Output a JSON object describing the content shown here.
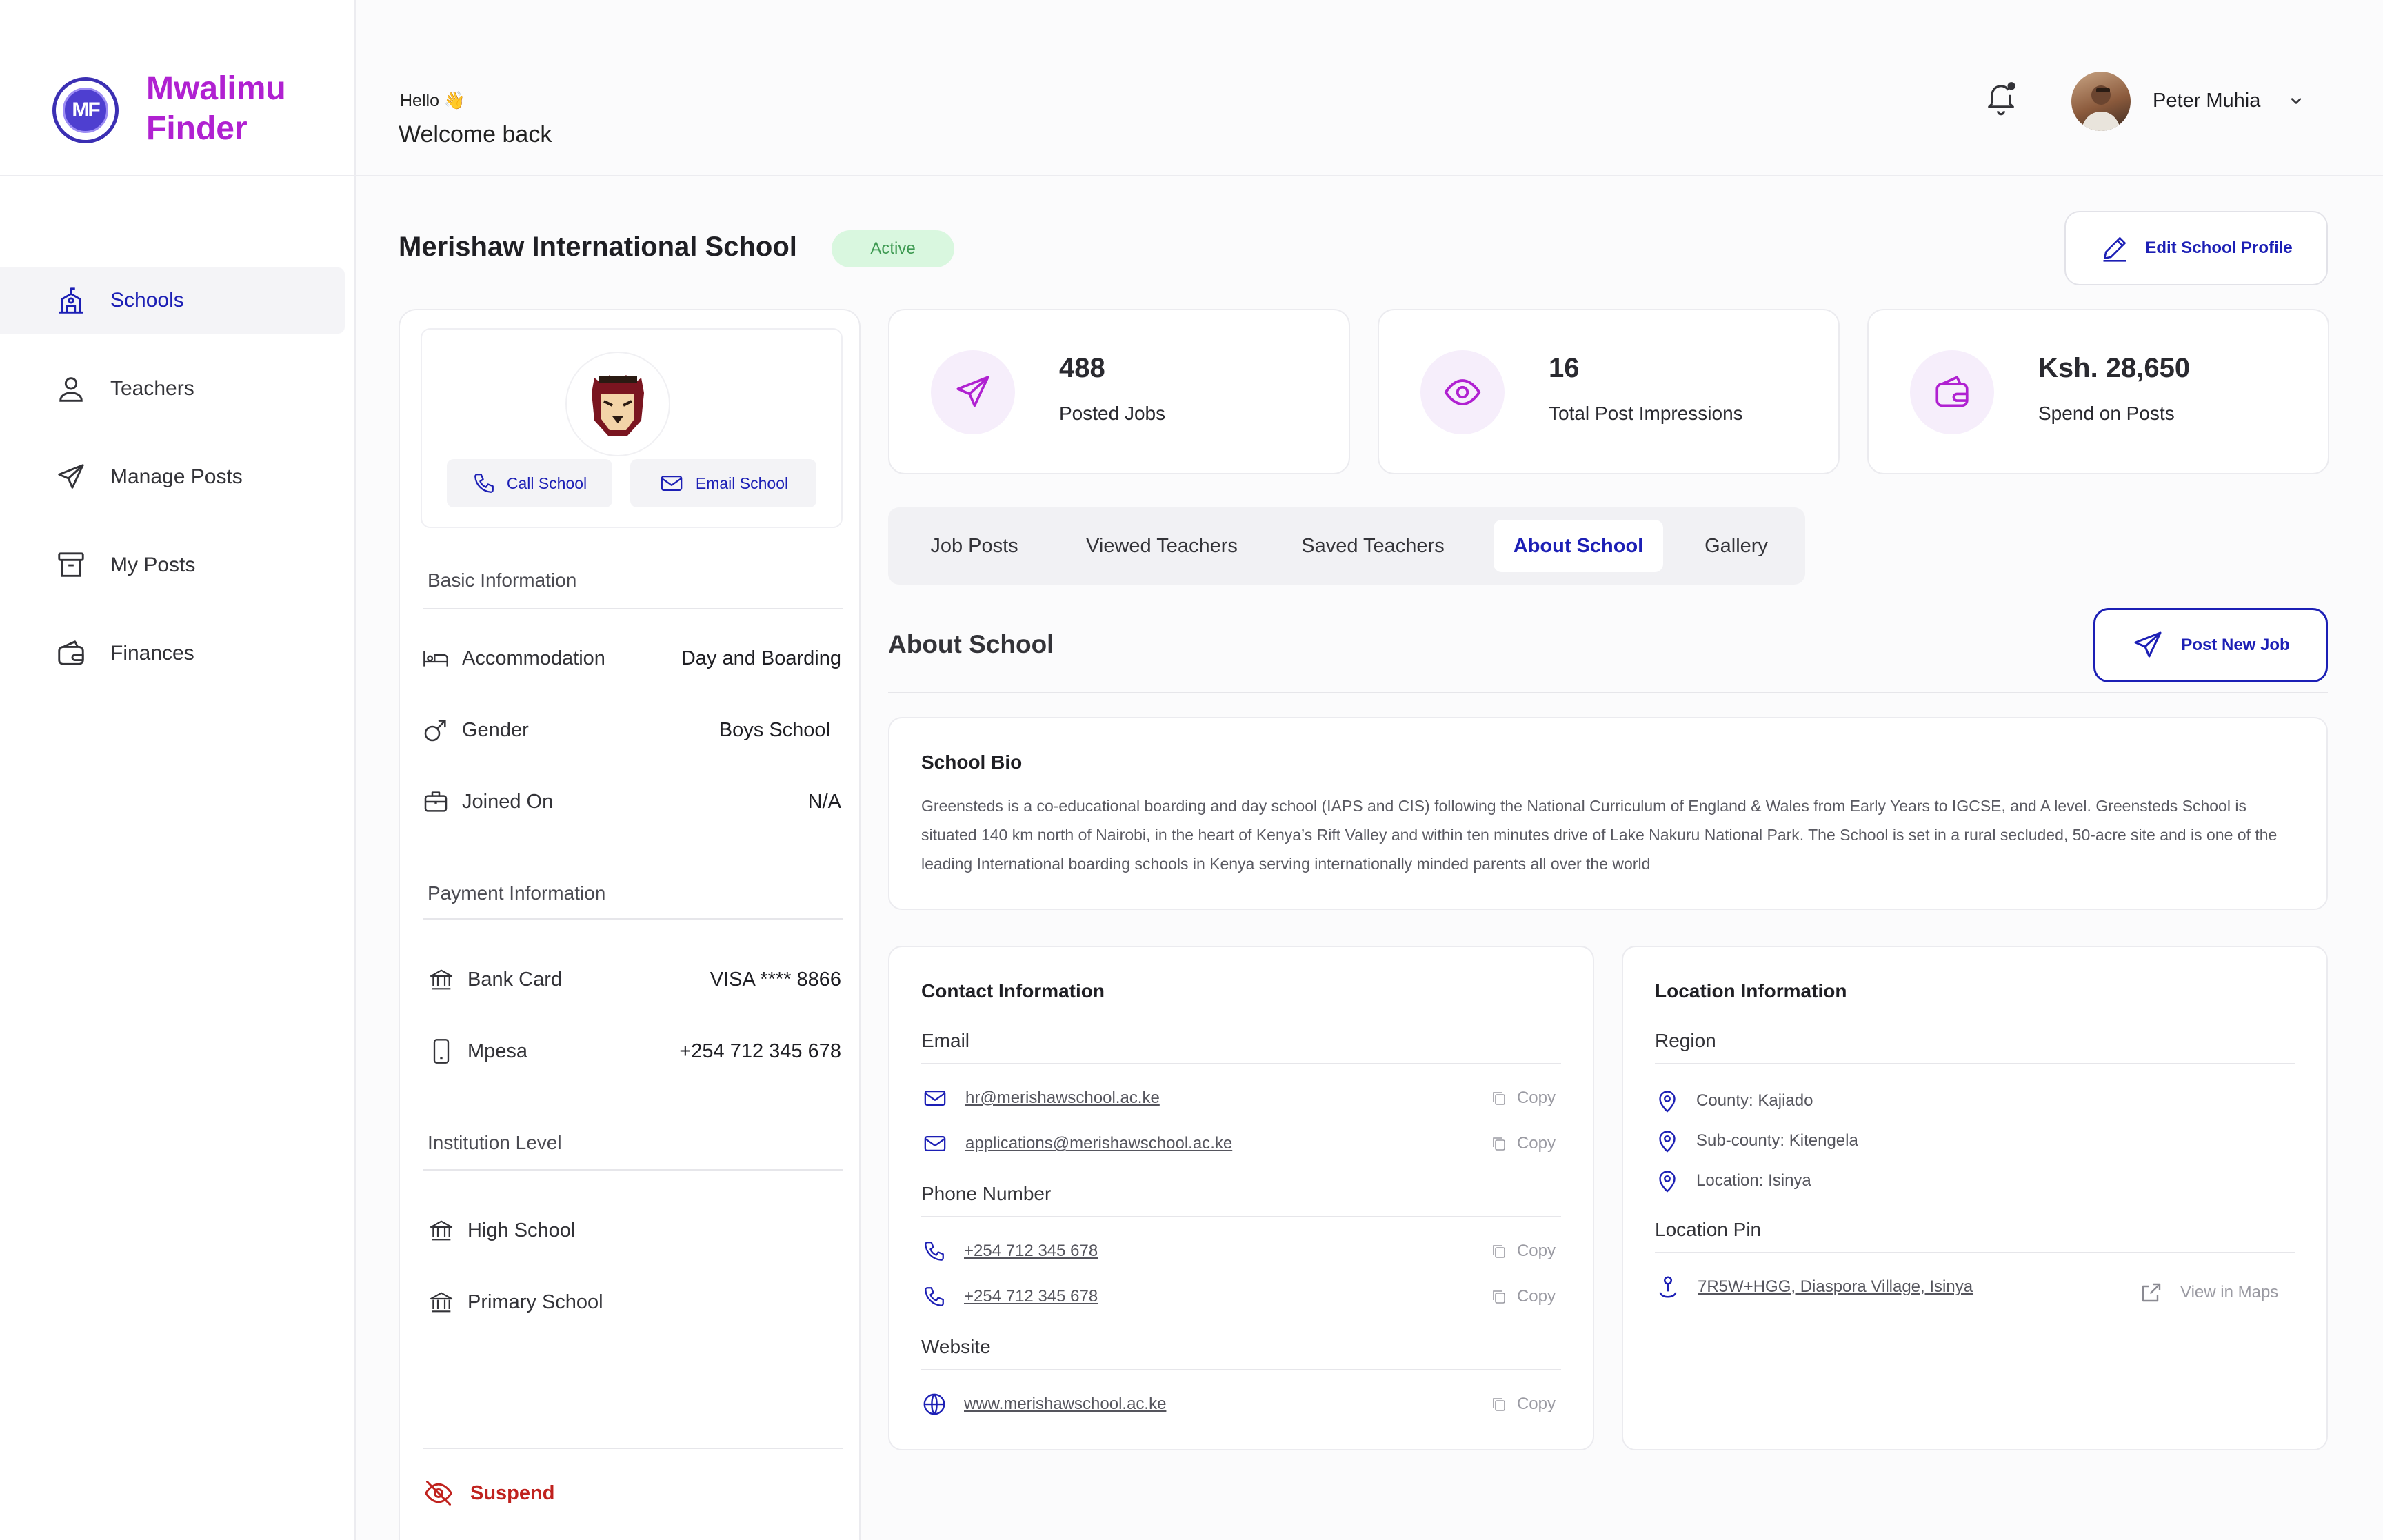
{
  "brand": {
    "name": "Mwalimu Finder"
  },
  "sidebar": {
    "items": [
      {
        "label": "Schools",
        "icon": "school-icon",
        "active": true
      },
      {
        "label": "Teachers",
        "icon": "user-icon",
        "active": false
      },
      {
        "label": "Manage Posts",
        "icon": "send-icon",
        "active": false
      },
      {
        "label": "My Posts",
        "icon": "archive-icon",
        "active": false
      },
      {
        "label": "Finances",
        "icon": "wallet-icon",
        "active": false
      }
    ]
  },
  "header": {
    "greeting": "Hello 👋",
    "subtitle": "Welcome back",
    "user_name": "Peter Muhia"
  },
  "school": {
    "name": "Merishaw International School",
    "status": "Active",
    "edit_label": "Edit School Profile",
    "call_label": "Call School",
    "email_label": "Email School"
  },
  "basic_info": {
    "title": "Basic Information",
    "rows": [
      {
        "label": "Accommodation",
        "value": "Day and Boarding",
        "icon": "bed-icon"
      },
      {
        "label": "Gender",
        "value": "Boys School",
        "icon": "male-icon"
      },
      {
        "label": "Joined On",
        "value": "N/A",
        "icon": "briefcase-icon"
      }
    ]
  },
  "payment_info": {
    "title": "Payment Information",
    "rows": [
      {
        "label": "Bank Card",
        "value": "VISA **** 8866",
        "icon": "bank-icon"
      },
      {
        "label": "Mpesa",
        "value": "+254 712 345 678",
        "icon": "phone-device-icon"
      }
    ]
  },
  "institution": {
    "title": "Institution Level",
    "levels": [
      "High School",
      "Primary School"
    ]
  },
  "suspend_label": "Suspend",
  "stats": [
    {
      "value": "488",
      "label": "Posted Jobs",
      "icon": "send-icon"
    },
    {
      "value": "16",
      "label": "Total Post Impressions",
      "icon": "eye-icon"
    },
    {
      "value": "Ksh. 28,650",
      "label": "Spend on Posts",
      "icon": "wallet-icon"
    }
  ],
  "tabs": [
    {
      "label": "Job Posts",
      "active": false
    },
    {
      "label": "Viewed Teachers",
      "active": false
    },
    {
      "label": "Saved Teachers",
      "active": false
    },
    {
      "label": "About School",
      "active": true
    },
    {
      "label": "Gallery",
      "active": false
    }
  ],
  "about": {
    "heading": "About School",
    "post_job_label": "Post New Job",
    "bio_title": "School Bio",
    "bio_text": "Greensteds is a co-educational boarding and day school (IAPS and CIS) following the National Curriculum of England & Wales from Early Years to IGCSE, and A level. Greensteds School is situated 140 km north of Nairobi, in the heart of Kenya’s Rift Valley and within ten minutes drive of Lake Nakuru National Park. The School is set in a rural secluded, 50-acre site and is one of the leading International boarding schools in Kenya serving internationally minded parents all over the world"
  },
  "contact": {
    "title": "Contact Information",
    "email_title": "Email",
    "emails": [
      "hr@merishawschool.ac.ke",
      "applications@merishawschool.ac.ke"
    ],
    "phone_title": "Phone Number",
    "phones": [
      "+254 712 345 678",
      "+254 712 345 678"
    ],
    "website_title": "Website",
    "website": "www.merishawschool.ac.ke",
    "copy_label": "Copy"
  },
  "location": {
    "title": "Location Information",
    "region_title": "Region",
    "region_rows": [
      "County: Kajiado",
      "Sub-county: Kitengela",
      "Location: Isinya"
    ],
    "pin_title": "Location Pin",
    "pin": "7R5W+HGG, Diaspora Village, Isinya",
    "maps_label": "View in Maps"
  },
  "colors": {
    "brand": "#b021d1",
    "accent": "#1c1fb5",
    "active_badge_bg": "#d9f7df",
    "danger": "#c0221e"
  }
}
